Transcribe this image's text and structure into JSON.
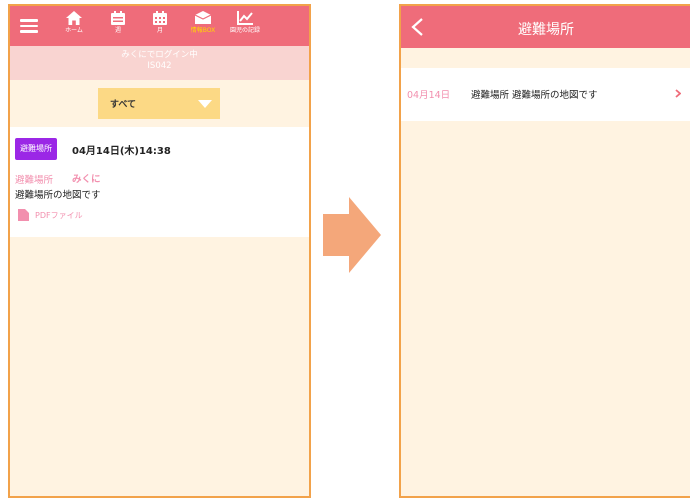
{
  "left_screen": {
    "nav": {
      "menu_icon": "hamburger-icon",
      "items": [
        {
          "label": "ホーム",
          "icon": "home-icon"
        },
        {
          "label": "週",
          "icon": "calendar-week-icon"
        },
        {
          "label": "月",
          "icon": "calendar-month-icon"
        },
        {
          "label": "情報BOX",
          "icon": "info-box-icon",
          "active": true
        },
        {
          "label": "園児の記録",
          "icon": "chart-icon"
        }
      ]
    },
    "login_status": {
      "line1": "みくにでログイン中",
      "line2": "IS042"
    },
    "filter": {
      "selected": "すべて"
    },
    "card": {
      "badge": "避難場所",
      "date": "04月14日(木)14:38",
      "category": "避難場所",
      "author": "みくに",
      "body": "避難場所の地図です",
      "attachment": "PDFファイル"
    }
  },
  "right_screen": {
    "title": "避難場所",
    "row": {
      "date": "04月14日",
      "text": "避難場所 避難場所の地図です"
    }
  },
  "colors": {
    "header": "#ef6c7a",
    "background": "#fff3e1",
    "accent_pink": "#f28fae",
    "badge_purple": "#9b27e6",
    "filter_yellow": "#fcd985",
    "active_nav": "#ffd700",
    "arrow": "#f4a77a",
    "frame": "#f2a24a"
  }
}
